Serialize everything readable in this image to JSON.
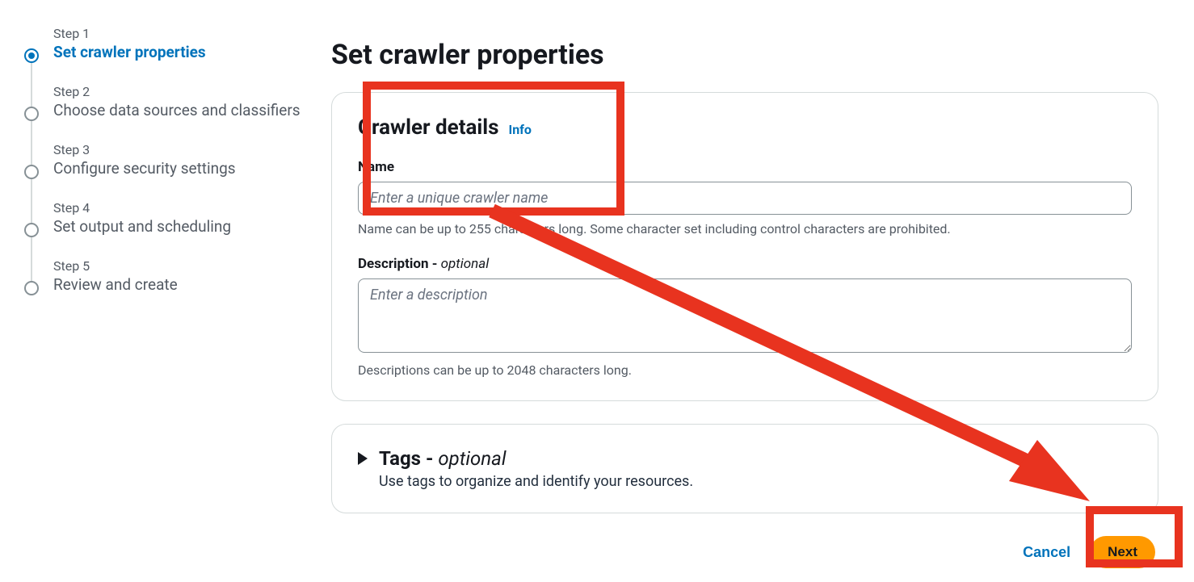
{
  "steps": [
    {
      "num": "Step 1",
      "title": "Set crawler properties"
    },
    {
      "num": "Step 2",
      "title": "Choose data sources and classifiers"
    },
    {
      "num": "Step 3",
      "title": "Configure security settings"
    },
    {
      "num": "Step 4",
      "title": "Set output and scheduling"
    },
    {
      "num": "Step 5",
      "title": "Review and create"
    }
  ],
  "page": {
    "title": "Set crawler properties"
  },
  "details": {
    "heading": "Crawler details",
    "info": "Info",
    "name_label": "Name",
    "name_placeholder": "Enter a unique crawler name",
    "name_hint": "Name can be up to 255 characters long. Some character set including control characters are prohibited.",
    "desc_label": "Description - ",
    "desc_optional": "optional",
    "desc_placeholder": "Enter a description",
    "desc_hint": "Descriptions can be up to 2048 characters long."
  },
  "tags": {
    "title": "Tags - ",
    "optional": "optional",
    "desc": "Use tags to organize and identify your resources."
  },
  "footer": {
    "cancel": "Cancel",
    "next": "Next"
  }
}
